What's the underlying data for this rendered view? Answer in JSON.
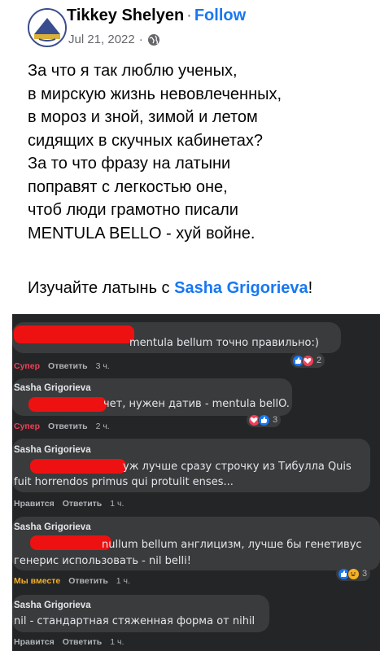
{
  "post": {
    "author": "Tikkey Shelyen",
    "separator": "·",
    "follow_label": "Follow",
    "date": "Jul 21, 2022",
    "date_separator": "·",
    "audience_icon": "globe-icon",
    "poem_lines": [
      "За что я так люблю ученых,",
      "в мирскую жизнь невовлеченных,",
      "в мороз и зной, зимой и летом",
      "сидящих в скучных кабинетах?",
      "За то что фразу на латыни",
      "поправят с легкостью оне,",
      "чтоб люди грамотно писали",
      "MENTULA BELLO - хуй войне."
    ],
    "cta_prefix": "Изучайте латынь с ",
    "cta_mention": "Sasha Grigorieva",
    "cta_suffix": "!"
  },
  "comments": [
    {
      "author": "",
      "text": "mentula bellum точно правильно:)",
      "reaction_label": "Супер",
      "reply_label": "Ответить",
      "time": "3 ч.",
      "reactions": [
        "like",
        "love"
      ],
      "reaction_count": "2"
    },
    {
      "author": "Sasha Grigorieva",
      "text": "чет, нужен датив - mentula bellO.",
      "reaction_label": "Супер",
      "reply_label": "Ответить",
      "time": "2 ч.",
      "reactions": [
        "love",
        "like"
      ],
      "reaction_count": "3"
    },
    {
      "author": "Sasha Grigorieva",
      "text_line1": "уж лучше сразу строчку из Тибулла Quis",
      "text_line2": "fuit horrendos primus qui protulit enses...",
      "reaction_label": "Нравится",
      "reply_label": "Ответить",
      "time": "1 ч."
    },
    {
      "author": "Sasha Grigorieva",
      "text_line1": "nullum bellum англицизм, лучше бы генетивус",
      "text_line2": "генерис использовать - nil belli!",
      "reaction_label": "Мы вместе",
      "reply_label": "Ответить",
      "time": "1 ч.",
      "reactions": [
        "like",
        "haha"
      ],
      "reaction_count": "3"
    },
    {
      "author": "Sasha Grigorieva",
      "text": "nil - стандартная стяженная форма от nihil",
      "reaction_label": "Нравится",
      "reply_label": "Ответить",
      "time": "1 ч."
    }
  ],
  "colors": {
    "follow": "#1877f2",
    "mention": "#1877f2",
    "panel_bg": "#242526",
    "bubble_bg": "#3a3b3c",
    "super_reaction": "#f33e58",
    "together_reaction": "#f7b125",
    "like_reaction": "#b0b3b8"
  }
}
